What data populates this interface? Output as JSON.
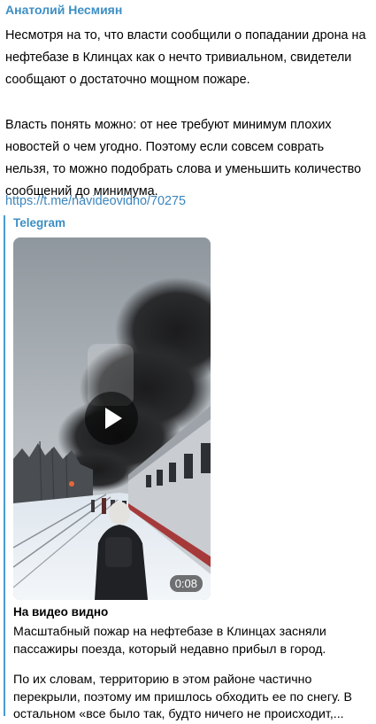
{
  "post": {
    "author": "Анатолий Несмиян",
    "paragraphs": [
      "Несмотря на то, что власти сообщили о попадании дрона на нефтебазе в Клинцах как о нечто тривиальном, свидетели сообщают о достаточно мощном пожаре.",
      "Власть понять можно: от нее требуют минимум плохих новостей о чем угодно. Поэтому если совсем соврать нельзя, то можно подобрать слова и уменьшить количество сообщений до минимума."
    ],
    "link": "https://t.me/navideovidno/70275"
  },
  "preview": {
    "site_name": "Telegram",
    "duration": "0:08",
    "title": "На видео видно",
    "paragraphs": [
      "Масштабный пожар на нефтебазе в Клинцах засняли пассажиры поезда, который недавно прибыл в город.",
      "По их словам, территорию в этом районе частично перекрыли, поэтому им пришлось обходить ее по снегу. В остальном «все было так, будто ничего не происходит,..."
    ]
  },
  "colors": {
    "accent": "#3d8fc4",
    "link": "#3a85bd",
    "quote_bar": "#4a9ad0"
  },
  "icons": {
    "play": "play-icon",
    "watermark": "channel-watermark-icon"
  }
}
